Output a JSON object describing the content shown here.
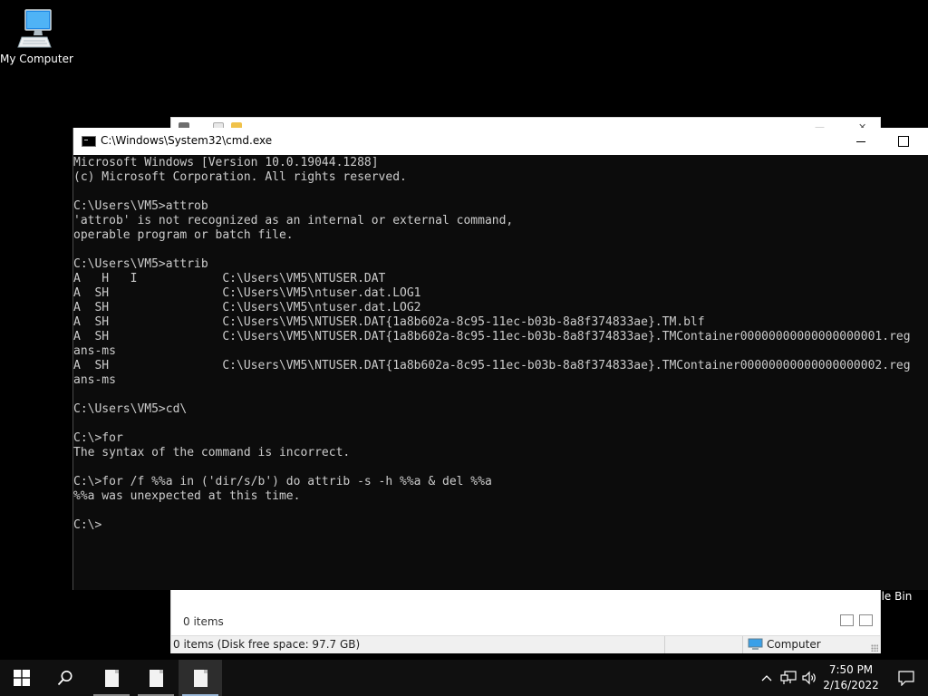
{
  "desktop": {
    "my_computer_label": "My Computer",
    "recycle_bin_label_partial": "cle Bin"
  },
  "explorer": {
    "items_count": "0 items",
    "status_left": "0 items (Disk free space: 97.7 GB)",
    "status_right": "Computer"
  },
  "cmd": {
    "title": "C:\\Windows\\System32\\cmd.exe",
    "lines": [
      "Microsoft Windows [Version 10.0.19044.1288]",
      "(c) Microsoft Corporation. All rights reserved.",
      "",
      "C:\\Users\\VM5>attrob",
      "'attrob' is not recognized as an internal or external command,",
      "operable program or batch file.",
      "",
      "C:\\Users\\VM5>attrib",
      "A   H   I            C:\\Users\\VM5\\NTUSER.DAT",
      "A  SH                C:\\Users\\VM5\\ntuser.dat.LOG1",
      "A  SH                C:\\Users\\VM5\\ntuser.dat.LOG2",
      "A  SH                C:\\Users\\VM5\\NTUSER.DAT{1a8b602a-8c95-11ec-b03b-8a8f374833ae}.TM.blf",
      "A  SH                C:\\Users\\VM5\\NTUSER.DAT{1a8b602a-8c95-11ec-b03b-8a8f374833ae}.TMContainer00000000000000000001.reg",
      "ans-ms",
      "A  SH                C:\\Users\\VM5\\NTUSER.DAT{1a8b602a-8c95-11ec-b03b-8a8f374833ae}.TMContainer00000000000000000002.reg",
      "ans-ms",
      "",
      "C:\\Users\\VM5>cd\\",
      "",
      "C:\\>for",
      "The syntax of the command is incorrect.",
      "",
      "C:\\>for /f %%a in ('dir/s/b') do attrib -s -h %%a & del %%a",
      "%%a was unexpected at this time.",
      "",
      "C:\\>"
    ]
  },
  "taskbar": {
    "time": "7:50 PM",
    "date": "2/16/2022",
    "tray_chevron": "^"
  },
  "colors": {
    "console_bg": "#0c0c0c",
    "console_fg": "#cccccc",
    "taskbar_bg": "#101010",
    "active_task_underline": "#9ab8d8"
  }
}
